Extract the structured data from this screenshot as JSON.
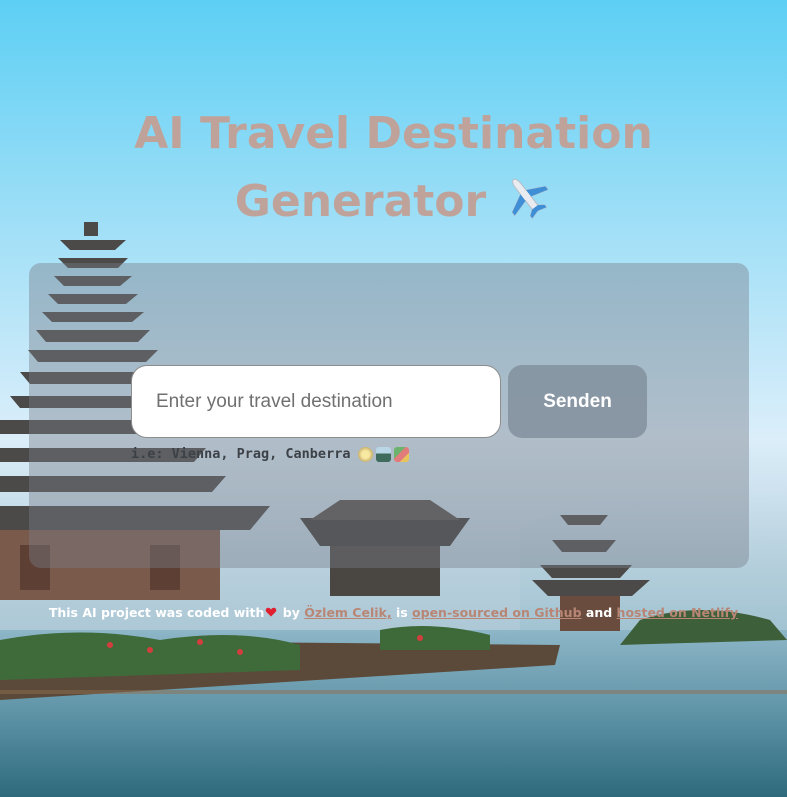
{
  "header": {
    "title_line1": "AI Travel Destination",
    "title_line2": "Generator",
    "title_icon": "airplane-icon"
  },
  "search": {
    "placeholder": "Enter your travel destination",
    "value": "",
    "submit_label": "Senden",
    "hint": "i.e: Vienna, Prag, Canberra",
    "hint_icons": [
      "compass-icon",
      "mountain-icon",
      "map-icon"
    ]
  },
  "footer": {
    "text_before": "This AI project was coded with",
    "heart_icon": "heart-icon",
    "by": "by",
    "author_link": "Özlem Celik,",
    "is_text": "is",
    "github_link": "open-sourced on Github",
    "and_text": "and",
    "netlify_link": "hosted on Netlify"
  },
  "colors": {
    "title": "#bfa39b",
    "link": "#b98676",
    "button_bg": "#82919e",
    "panel_bg": "rgba(120,125,135,0.42)"
  }
}
